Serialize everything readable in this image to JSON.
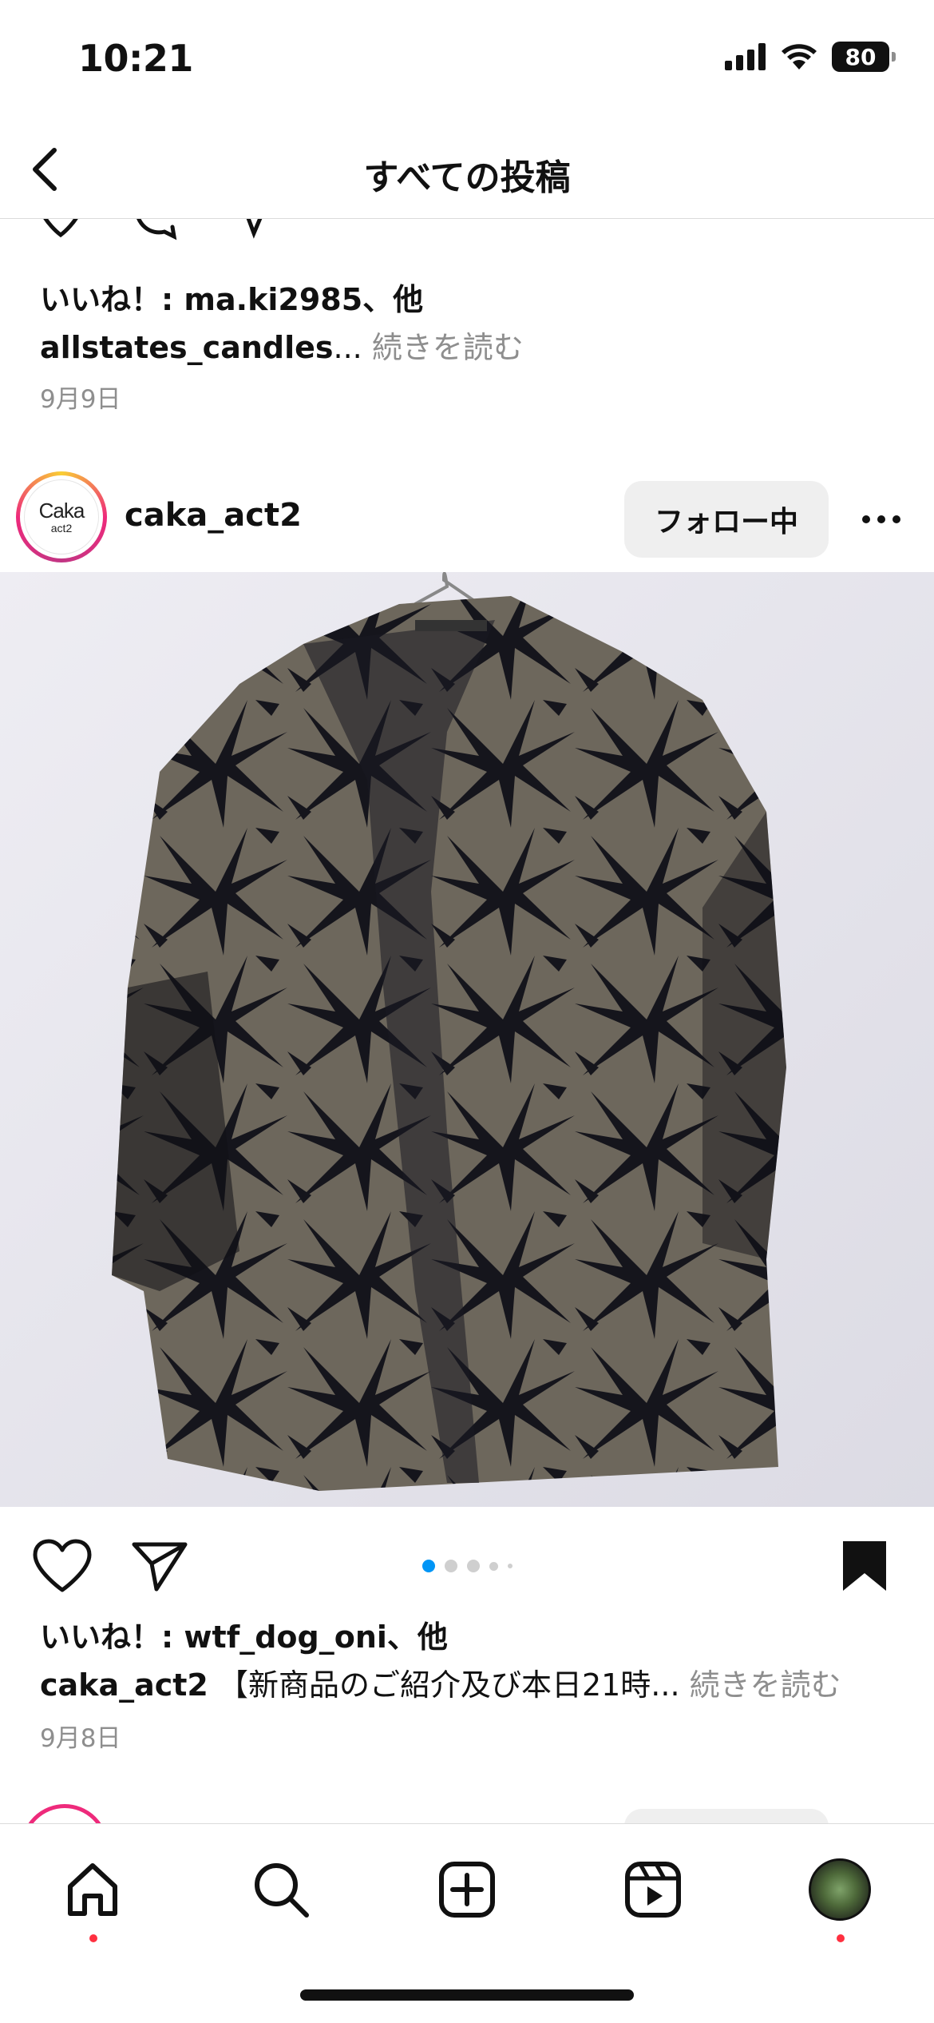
{
  "status_bar": {
    "time": "10:21",
    "battery": "80"
  },
  "nav": {
    "title": "すべての投稿"
  },
  "previous_post": {
    "likes": "いいね！: ma.ki2985、他",
    "caption_user": "allstates_candles",
    "caption_text": "...",
    "more_label": " 続きを読む",
    "date": "9月9日"
  },
  "post": {
    "username": "caka_act2",
    "avatar_logo_main": "Caka",
    "avatar_logo_sub": "act2",
    "follow_label": "フォロー中",
    "image_description_icon": "photo",
    "carousel": {
      "total": 5,
      "active": 1
    },
    "likes": "いいね！: wtf_dog_oni、他",
    "caption_user": "caka_act2",
    "caption_text": " 【新商品のご紹介及び本日21時...",
    "more_label": " 続きを読む",
    "date": "9月8日"
  },
  "tab_bar": {
    "items": [
      "home-icon",
      "search-icon",
      "create-icon",
      "reels-icon",
      "profile-avatar"
    ]
  },
  "colors": {
    "accent": "#0095f6",
    "notification": "#ff3040",
    "muted": "#8e8e8e"
  }
}
